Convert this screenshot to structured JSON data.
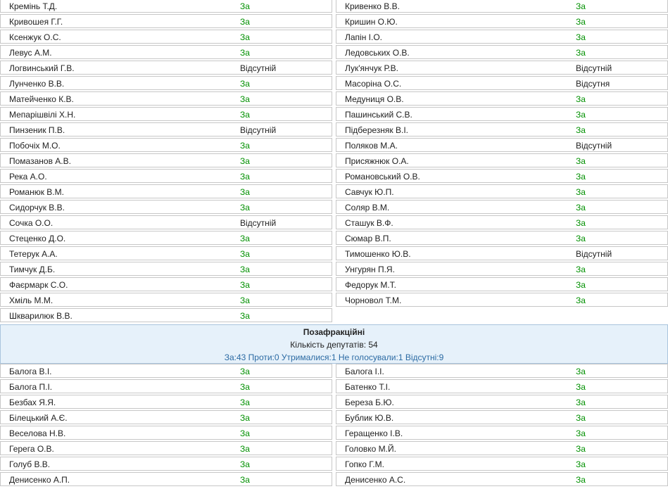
{
  "top_rows": [
    [
      {
        "name": "Кремінь Т.Д.",
        "vote": "За"
      },
      {
        "name": "Кривенко В.В.",
        "vote": "За"
      }
    ],
    [
      {
        "name": "Кривошея Г.Г.",
        "vote": "За"
      },
      {
        "name": "Кришин О.Ю.",
        "vote": "За"
      }
    ],
    [
      {
        "name": "Ксенжук О.С.",
        "vote": "За"
      },
      {
        "name": "Лапін І.О.",
        "vote": "За"
      }
    ],
    [
      {
        "name": "Левус А.М.",
        "vote": "За"
      },
      {
        "name": "Ледовських О.В.",
        "vote": "За"
      }
    ],
    [
      {
        "name": "Логвинський Г.В.",
        "vote": "Відсутній"
      },
      {
        "name": "Лук'янчук Р.В.",
        "vote": "Відсутній"
      }
    ],
    [
      {
        "name": "Лунченко В.В.",
        "vote": "За"
      },
      {
        "name": "Масоріна О.С.",
        "vote": "Відсутня"
      }
    ],
    [
      {
        "name": "Матейченко К.В.",
        "vote": "За"
      },
      {
        "name": "Медуниця О.В.",
        "vote": "За"
      }
    ],
    [
      {
        "name": "Мепарішвілі Х.Н.",
        "vote": "За"
      },
      {
        "name": "Пашинський С.В.",
        "vote": "За"
      }
    ],
    [
      {
        "name": "Пинзеник П.В.",
        "vote": "Відсутній"
      },
      {
        "name": "Підберезняк В.І.",
        "vote": "За"
      }
    ],
    [
      {
        "name": "Побочіх М.О.",
        "vote": "За"
      },
      {
        "name": "Поляков М.А.",
        "vote": "Відсутній"
      }
    ],
    [
      {
        "name": "Помазанов А.В.",
        "vote": "За"
      },
      {
        "name": "Присяжнюк О.А.",
        "vote": "За"
      }
    ],
    [
      {
        "name": "Река А.О.",
        "vote": "За"
      },
      {
        "name": "Романовський О.В.",
        "vote": "За"
      }
    ],
    [
      {
        "name": "Романюк В.М.",
        "vote": "За"
      },
      {
        "name": "Савчук Ю.П.",
        "vote": "За"
      }
    ],
    [
      {
        "name": "Сидорчук В.В.",
        "vote": "За"
      },
      {
        "name": "Соляр В.М.",
        "vote": "За"
      }
    ],
    [
      {
        "name": "Сочка О.О.",
        "vote": "Відсутній"
      },
      {
        "name": "Сташук В.Ф.",
        "vote": "За"
      }
    ],
    [
      {
        "name": "Стеценко Д.О.",
        "vote": "За"
      },
      {
        "name": "Сюмар В.П.",
        "vote": "За"
      }
    ],
    [
      {
        "name": "Тетерук А.А.",
        "vote": "За"
      },
      {
        "name": "Тимошенко Ю.В.",
        "vote": "Відсутній"
      }
    ],
    [
      {
        "name": "Тимчук Д.Б.",
        "vote": "За"
      },
      {
        "name": "Унгурян П.Я.",
        "vote": "За"
      }
    ],
    [
      {
        "name": "Фаєрмарк С.О.",
        "vote": "За"
      },
      {
        "name": "Федорук М.Т.",
        "vote": "За"
      }
    ],
    [
      {
        "name": "Хміль М.М.",
        "vote": "За"
      },
      {
        "name": "Чорновол Т.М.",
        "vote": "За"
      }
    ],
    [
      {
        "name": "Шкварилюк В.В.",
        "vote": "За"
      },
      null
    ]
  ],
  "faction": {
    "title": "Позафракційні",
    "count_text": "Кількість депутатів: 54",
    "summary_text": "За:43 Проти:0 Утрималися:1 Не голосували:1 Відсутні:9"
  },
  "bottom_rows": [
    [
      {
        "name": "Балога В.І.",
        "vote": "За"
      },
      {
        "name": "Балога І.І.",
        "vote": "За"
      }
    ],
    [
      {
        "name": "Балога П.І.",
        "vote": "За"
      },
      {
        "name": "Батенко Т.І.",
        "vote": "За"
      }
    ],
    [
      {
        "name": "Безбах Я.Я.",
        "vote": "За"
      },
      {
        "name": "Береза Б.Ю.",
        "vote": "За"
      }
    ],
    [
      {
        "name": "Білецький А.Є.",
        "vote": "За"
      },
      {
        "name": "Бублик Ю.В.",
        "vote": "За"
      }
    ],
    [
      {
        "name": "Веселова Н.В.",
        "vote": "За"
      },
      {
        "name": "Геращенко І.В.",
        "vote": "За"
      }
    ],
    [
      {
        "name": "Герега О.В.",
        "vote": "За"
      },
      {
        "name": "Головко М.Й.",
        "vote": "За"
      }
    ],
    [
      {
        "name": "Голуб В.В.",
        "vote": "За"
      },
      {
        "name": "Гопко Г.М.",
        "vote": "За"
      }
    ],
    [
      {
        "name": "Денисенко А.П.",
        "vote": "За"
      },
      {
        "name": "Денисенко А.С.",
        "vote": "За"
      }
    ]
  ],
  "colors": {
    "vote_for": "#009000",
    "faction_background": "#e6f1fa",
    "faction_summary": "#2b6aa3",
    "cell_border": "#c7c7c7"
  }
}
